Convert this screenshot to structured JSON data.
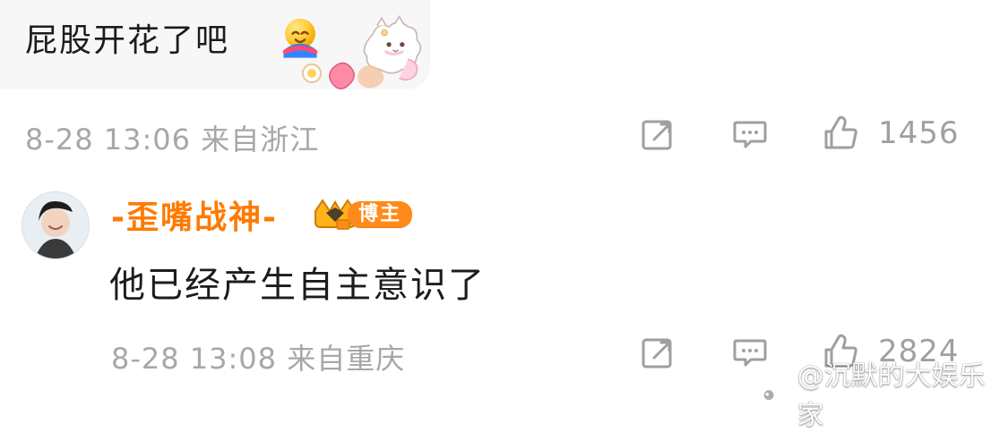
{
  "top_comment": {
    "text": "屁股开花了吧",
    "meta": "8-28 13:06 来自浙江",
    "like_count": "1456"
  },
  "reply": {
    "username": "-歪嘴战神-",
    "badge_label": "博主",
    "text": "他已经产生自主意识了",
    "meta": "8-28 13:08 来自重庆",
    "like_count": "2824"
  },
  "watermark": {
    "text": "@沉默的大娱乐家"
  },
  "icons": {
    "share": "share-icon",
    "comment": "comment-icon",
    "like": "thumbs-up-icon",
    "weibo": "weibo-logo"
  },
  "colors": {
    "text_primary": "#1c1c1c",
    "meta_gray": "#a7a7a7",
    "icon_gray": "#9f9f9f",
    "username_orange": "#ff7a00",
    "badge_orange": "#ff8a1a",
    "bubble_bg": "#f7f7f7"
  }
}
